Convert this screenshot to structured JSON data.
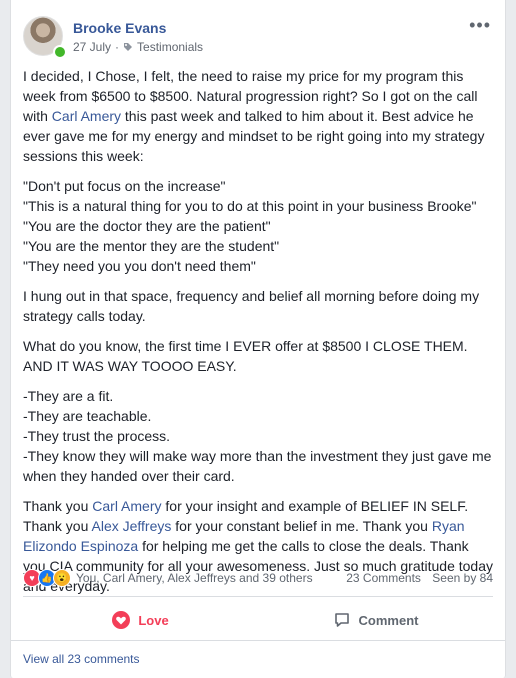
{
  "post": {
    "author": "Brooke Evans",
    "date": "27 July",
    "group": "Testimonials",
    "more_icon": "•••"
  },
  "body": {
    "p1_a": "I decided, I Chose, I felt, the need to raise my price for my program this week from $6500 to $8500. Natural progression right? So I got on the call with ",
    "p1_link": "Carl Amery",
    "p1_b": " this past week and talked to him about it. Best advice he ever gave me for my energy and mindset to be right going into my strategy sessions this week:",
    "quotes": [
      "\"Don't put focus on the increase\"",
      "\"This is a natural thing for you to do at this point in your business Brooke\"",
      "\"You are the doctor they are the patient\"",
      "\"You are the mentor they are the student\"",
      "\"They need you you don't need them\""
    ],
    "p3": "I hung out in that space, frequency and belief all morning before doing my strategy calls today.",
    "p4": "What do you know, the first time I EVER offer at $8500 I CLOSE THEM. AND IT WAS WAY TOOOO EASY.",
    "list": [
      "-They are a fit.",
      "-They are teachable.",
      "-They trust the process.",
      "-They know they will make way more than the investment they just gave me when they handed over their card."
    ],
    "p6_a": "Thank you ",
    "p6_link1": "Carl Amery",
    "p6_b": " for your insight and example of BELIEF IN SELF. Thank you ",
    "p6_link2": "Alex Jeffreys",
    "p6_c": " for your constant belief in me. Thank you ",
    "p6_link3": "Ryan Elizondo Espinoza",
    "p6_d": " for helping me get the calls to close the deals. Thank you CIA community for all your awesomeness. Just so much gratitude today and everyday."
  },
  "reactions": {
    "summary": "You, Carl Amery, Alex Jeffreys and 39 others",
    "comments": "23 Comments",
    "seen": "Seen by 84"
  },
  "actions": {
    "love": "Love",
    "comment": "Comment"
  },
  "view_all": "View all 23 comments",
  "colors": {
    "link": "#385898",
    "love": "#f33e58",
    "like": "#1877f2",
    "online": "#42b72a"
  }
}
